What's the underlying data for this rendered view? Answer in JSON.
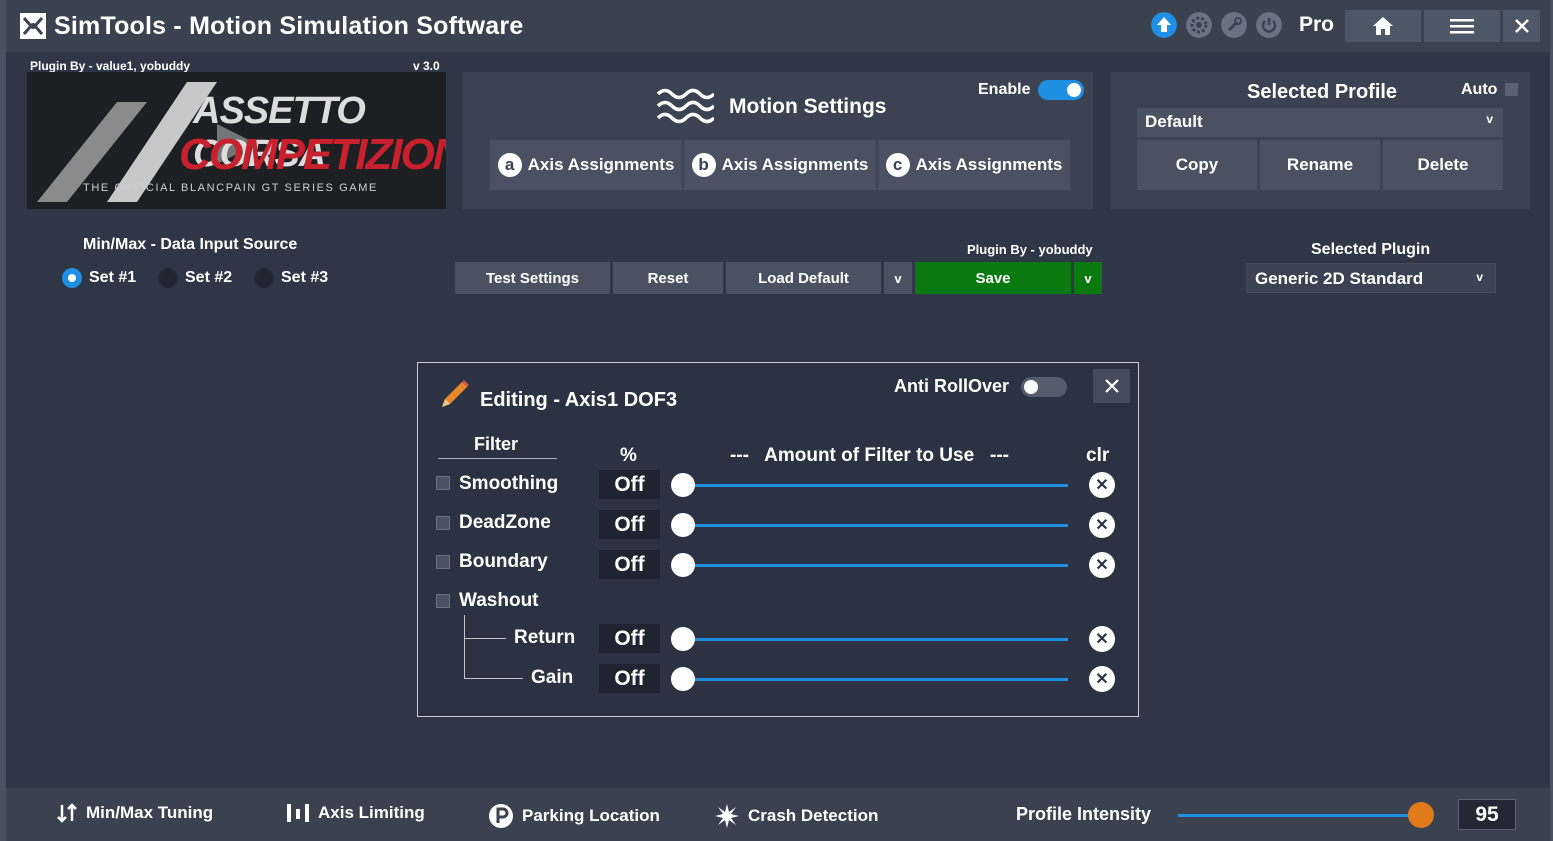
{
  "app": {
    "title": "SimTools - Motion Simulation Software",
    "pro_label": "Pro"
  },
  "plugin_banner": {
    "plugin_by": "Plugin By - value1, yobuddy",
    "version": "v 3.0",
    "game_title_1": "ASSETTO CORSA",
    "game_title_2": "COMPETIZIONE",
    "game_subtitle": "THE OFFICIAL BLANCPAIN GT SERIES GAME"
  },
  "motion_settings": {
    "title": "Motion Settings",
    "enable_label": "Enable",
    "enabled": true,
    "axis_tabs": [
      {
        "letter": "a",
        "label": "Axis Assignments"
      },
      {
        "letter": "b",
        "label": "Axis Assignments"
      },
      {
        "letter": "c",
        "label": "Axis Assignments"
      }
    ]
  },
  "profile": {
    "title": "Selected Profile",
    "auto_label": "Auto",
    "selected": "Default",
    "buttons": {
      "copy": "Copy",
      "rename": "Rename",
      "delete": "Delete"
    }
  },
  "input_source": {
    "title": "Min/Max - Data Input Source",
    "options": [
      "Set #1",
      "Set #2",
      "Set #3"
    ],
    "selected_index": 0
  },
  "actions": {
    "test": "Test Settings",
    "reset": "Reset",
    "load_default": "Load Default",
    "load_chevron": "v",
    "save": "Save",
    "save_chevron": "v",
    "plugin_by": "Plugin By - yobuddy"
  },
  "selected_plugin": {
    "title": "Selected Plugin",
    "value": "Generic 2D Standard"
  },
  "editor": {
    "title": "Editing - Axis1 DOF3",
    "anti_rollover_label": "Anti RollOver",
    "col_filter": "Filter",
    "col_pct": "%",
    "col_amount": "---   Amount of Filter to Use   ---",
    "col_clr": "clr",
    "filters": [
      {
        "label": "Smoothing",
        "value": "Off"
      },
      {
        "label": "DeadZone",
        "value": "Off"
      },
      {
        "label": "Boundary",
        "value": "Off"
      },
      {
        "label": "Washout",
        "value": ""
      },
      {
        "label": "Return",
        "value": "Off"
      },
      {
        "label": "Gain",
        "value": "Off"
      }
    ]
  },
  "bottom_bar": {
    "minmax": "Min/Max Tuning",
    "axis_limiting": "Axis Limiting",
    "parking": "Parking Location",
    "crash": "Crash Detection",
    "intensity_label": "Profile Intensity",
    "intensity_value": "95"
  },
  "colors": {
    "accent": "#1e8fe3",
    "save_green": "#0a7a10",
    "intensity_knob": "#e07a1a"
  }
}
